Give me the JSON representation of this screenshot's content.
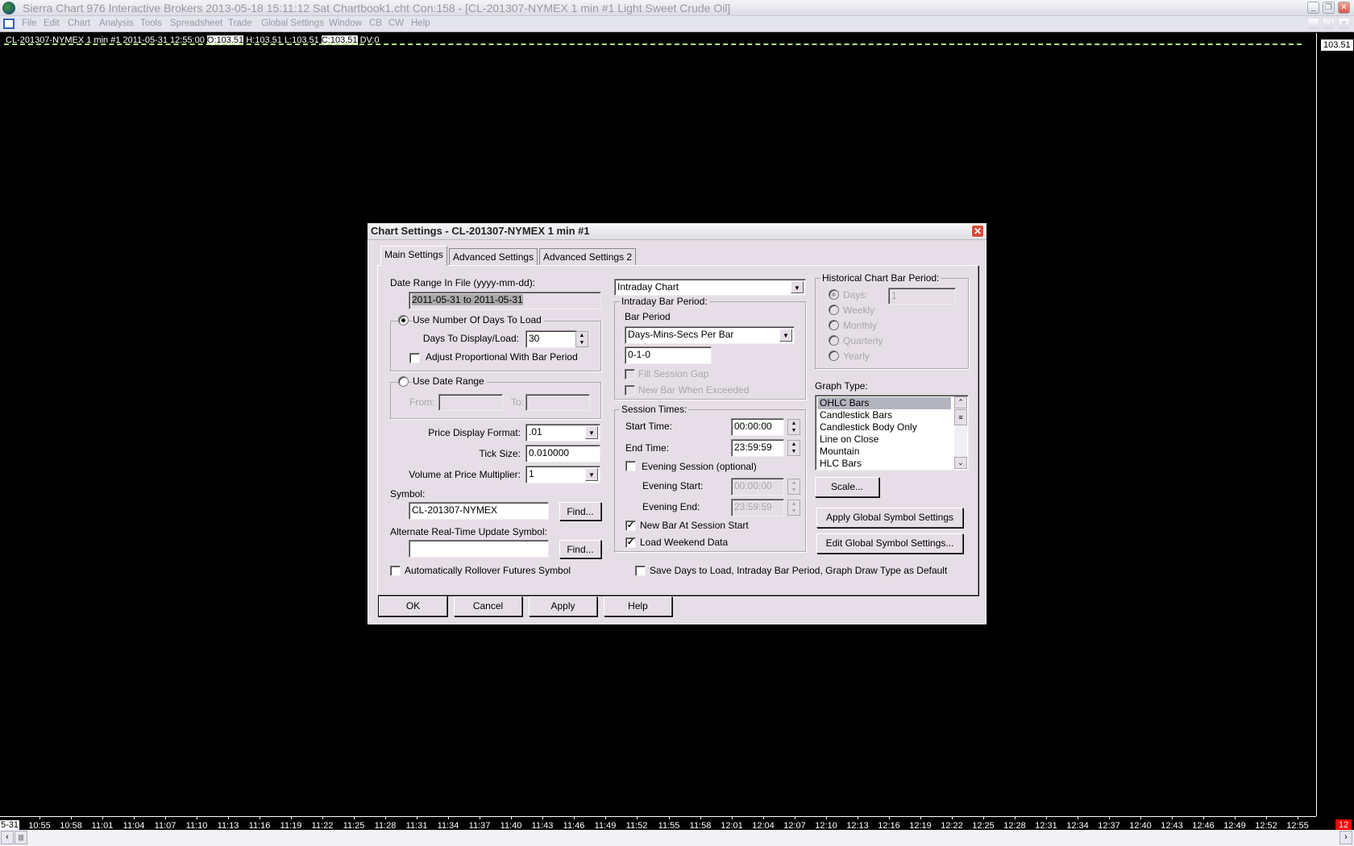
{
  "window": {
    "title": "Sierra Chart 976 Interactive Brokers 2013-05-18  15:11:12 Sat  Chartbook1.cht Con:158 - [CL-201307-NYMEX  1 min   #1  Light Sweet Crude Oil]",
    "menu": [
      "File",
      "Edit",
      "Chart",
      "Analysis",
      "Tools",
      "Spreadsheet",
      "Trade",
      "Global Settings",
      "Window",
      "CB",
      "CW",
      "Help"
    ]
  },
  "chart": {
    "header": {
      "symbol": "CL-201307-NYMEX  1 min   #1 2011-05-31 12:55:00",
      "open": "O:103.51",
      "high": "H:103.51",
      "low": "L:103.51",
      "close": "C:103.51",
      "dv": "DV:0"
    },
    "price_label": "103.51",
    "date_label": "5-31",
    "time_labels": [
      "10:55",
      "10:58",
      "11:01",
      "11:04",
      "11:07",
      "11:10",
      "11:13",
      "11:16",
      "11:19",
      "11:22",
      "11:25",
      "11:28",
      "11:31",
      "11:34",
      "11:37",
      "11:40",
      "11:43",
      "11:46",
      "11:49",
      "11:52",
      "11:55",
      "11:58",
      "12:01",
      "12:04",
      "12:07",
      "12:10",
      "12:13",
      "12:16",
      "12:19",
      "12:22",
      "12:25",
      "12:28",
      "12:31",
      "12:34",
      "12:37",
      "12:40",
      "12:43",
      "12:46",
      "12:49",
      "12:52",
      "12:55"
    ],
    "hour_label": "12",
    "line_color": "#b4f07a"
  },
  "dialog": {
    "title": "Chart Settings - CL-201307-NYMEX  1 min   #1",
    "tabs": [
      "Main Settings",
      "Advanced Settings",
      "Advanced Settings 2"
    ],
    "date_range_label": "Date Range In File (yyyy-mm-dd):",
    "date_range_value": "2011-05-31 to 2011-05-31",
    "use_days_label": "Use Number Of Days To Load",
    "days_label": "Days To Display/Load:",
    "days_value": "30",
    "adjust_label": "Adjust Proportional With Bar Period",
    "use_date_range_label": "Use Date Range",
    "from_label": "From:",
    "to_label": "To:",
    "price_format_label": "Price Display Format:",
    "price_format_value": ".01",
    "tick_size_label": "Tick Size:",
    "tick_size_value": "0.010000",
    "vap_label": "Volume at Price Multiplier:",
    "vap_value": "1",
    "symbol_label": "Symbol:",
    "symbol_value": "CL-201307-NYMEX",
    "find_label": "Find...",
    "alt_symbol_label": "Alternate Real-Time Update Symbol:",
    "alt_symbol_value": "",
    "rollover_label": "Automatically Rollover Futures Symbol",
    "chart_type_value": "Intraday Chart",
    "intraday_group": "Intraday Bar Period:",
    "bar_period_label": "Bar Period",
    "bar_period_type": "Days-Mins-Secs Per Bar",
    "bar_period_value": "0-1-0",
    "fill_gap_label": "Fill Session Gap",
    "new_bar_exceeded_label": "New Bar When Exceeded",
    "session_group": "Session Times:",
    "start_time_label": "Start Time:",
    "start_time_value": "00:00:00",
    "end_time_label": "End Time:",
    "end_time_value": "23:59:59",
    "evening_label": "Evening Session (optional)",
    "evening_start_label": "Evening Start:",
    "evening_start_value": "00:00:00",
    "evening_end_label": "Evening End:",
    "evening_end_value": "23:59:59",
    "new_bar_session_label": "New Bar At Session Start",
    "weekend_label": "Load Weekend Data",
    "save_default_label": "Save Days to Load, Intraday Bar Period, Graph Draw Type as Default",
    "historical_group": "Historical Chart Bar Period:",
    "hist_days_label": "Days:",
    "hist_days_value": "1",
    "hist_options": [
      "Weekly",
      "Monthly",
      "Quarterly",
      "Yearly"
    ],
    "graph_type_label": "Graph Type:",
    "graph_types": [
      "OHLC Bars",
      "Candlestick Bars",
      "Candlestick Body Only",
      "Line on Close",
      "Mountain",
      "HLC Bars"
    ],
    "scale_label": "Scale...",
    "apply_global_label": "Apply Global Symbol Settings",
    "edit_global_label": "Edit Global Symbol Settings...",
    "ok_label": "OK",
    "cancel_label": "Cancel",
    "apply_label": "Apply",
    "help_label": "Help"
  }
}
